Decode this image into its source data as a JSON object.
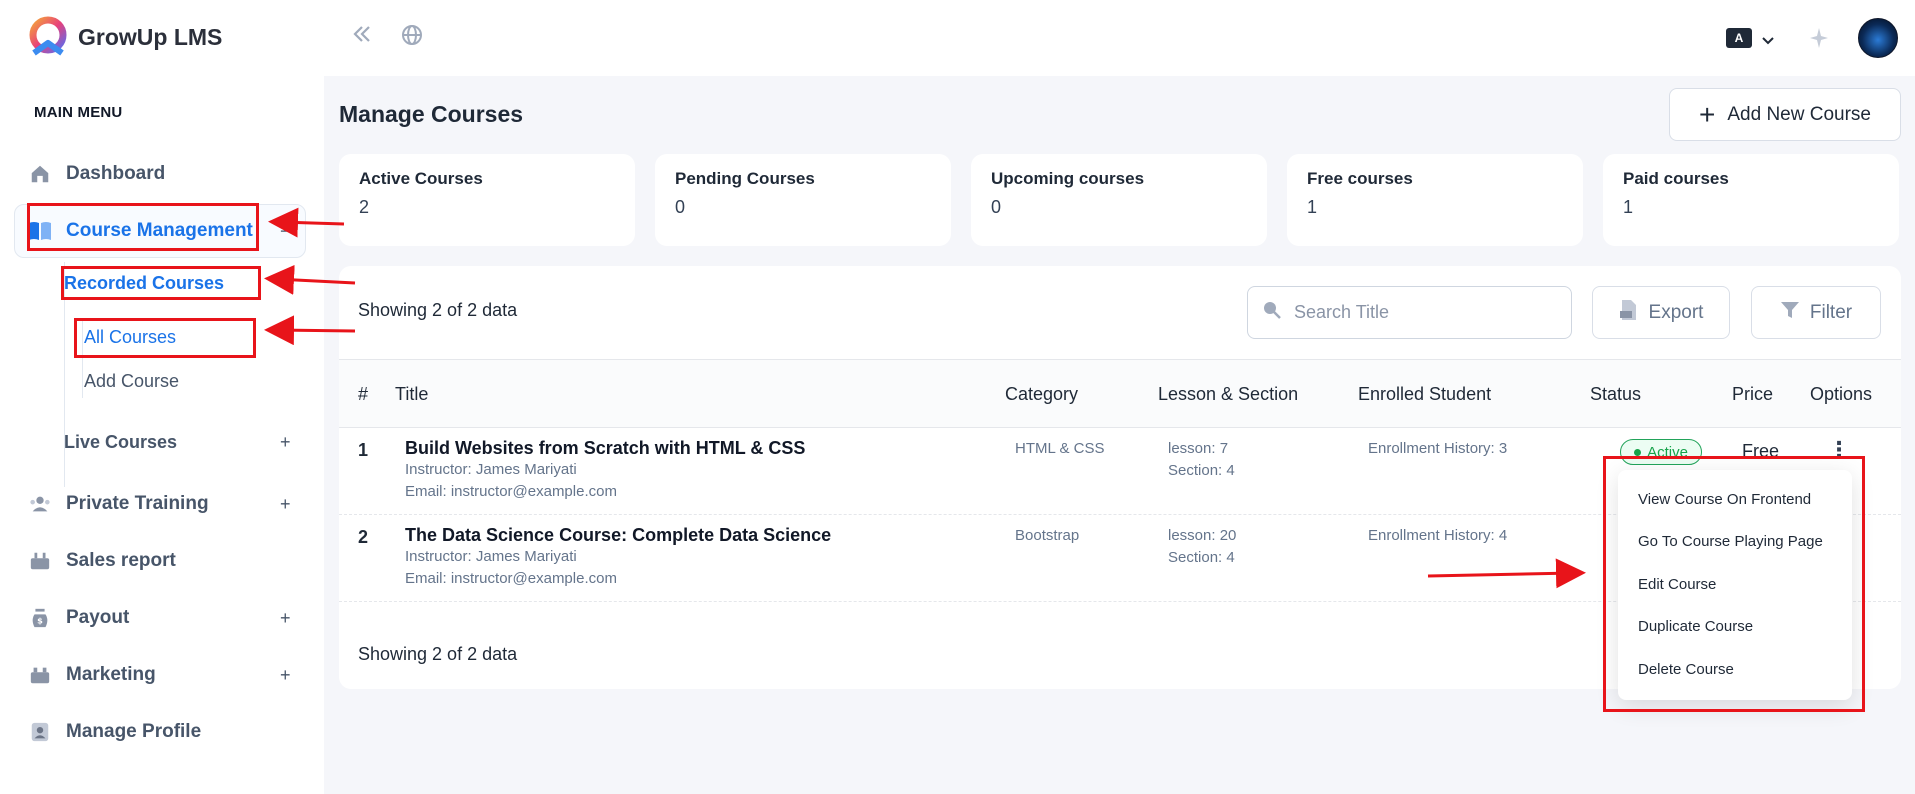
{
  "brand": {
    "name": "GrowUp LMS"
  },
  "sidebar": {
    "heading": "MAIN MENU",
    "items": [
      {
        "label": "Dashboard",
        "icon": "home-icon",
        "expand": ""
      },
      {
        "label": "Course Management",
        "icon": "book-icon",
        "expand": "−"
      },
      {
        "label": "Private Training",
        "icon": "users-icon",
        "expand": "+"
      },
      {
        "label": "Sales report",
        "icon": "chart-icon",
        "expand": ""
      },
      {
        "label": "Payout",
        "icon": "money-bag-icon",
        "expand": "+"
      },
      {
        "label": "Marketing",
        "icon": "megaphone-icon",
        "expand": "+"
      },
      {
        "label": "Manage Profile",
        "icon": "profile-icon",
        "expand": ""
      }
    ],
    "recorded_courses": {
      "label": "Recorded Courses",
      "expand": "−"
    },
    "recorded_sub": [
      "All Courses",
      "Add Course"
    ],
    "live_courses": {
      "label": "Live Courses",
      "expand": "+"
    }
  },
  "topbar": {
    "collapse_icon": "double-chevron-left-icon",
    "globe_icon": "globe-icon",
    "lang_badge": "A",
    "sparkle_icon": "sparkle-icon"
  },
  "page": {
    "title": "Manage Courses",
    "add_button": "Add New Course"
  },
  "stats": [
    {
      "label": "Active Courses",
      "value": "2"
    },
    {
      "label": "Pending Courses",
      "value": "0"
    },
    {
      "label": "Upcoming courses",
      "value": "0"
    },
    {
      "label": "Free courses",
      "value": "1"
    },
    {
      "label": "Paid courses",
      "value": "1"
    }
  ],
  "toolbar": {
    "showing_top": "Showing 2 of 2 data",
    "search_placeholder": "Search Title",
    "export_label": "Export",
    "filter_label": "Filter"
  },
  "table": {
    "headers": [
      "#",
      "Title",
      "Category",
      "Lesson & Section",
      "Enrolled Student",
      "Status",
      "Price",
      "Options"
    ],
    "rows": [
      {
        "num": "1",
        "title": "Build Websites from Scratch with HTML & CSS",
        "instructor": "Instructor: James Mariyati",
        "email": "Email: instructor@example.com",
        "category": "HTML & CSS",
        "lessons": "lesson: 7",
        "sections": "Section: 4",
        "enrolled": "Enrollment History: 3",
        "status": "Active",
        "price": "Free"
      },
      {
        "num": "2",
        "title": "The Data Science Course: Complete Data Science",
        "instructor": "Instructor: James Mariyati",
        "email": "Email: instructor@example.com",
        "category": "Bootstrap",
        "lessons": "lesson: 20",
        "sections": "Section: 4",
        "enrolled": "Enrollment History: 4"
      }
    ],
    "showing_bottom": "Showing 2 of 2 data"
  },
  "options_menu": [
    "View Course On Frontend",
    "Go To Course Playing Page",
    "Edit Course",
    "Duplicate Course",
    "Delete Course"
  ],
  "colors": {
    "accent": "#1a73e8",
    "annotation": "#e8141a",
    "active_status": "#16a34a"
  }
}
